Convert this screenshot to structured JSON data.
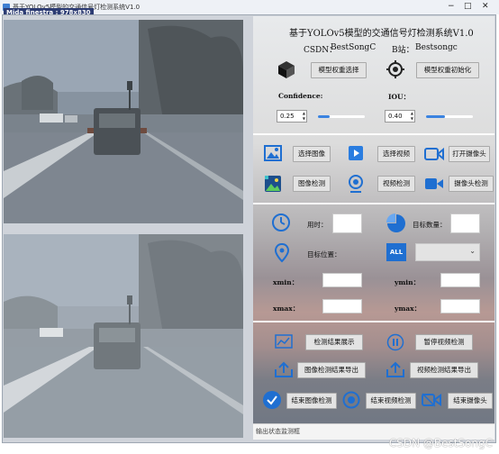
{
  "window": {
    "title": "基于YOLOv5模型的交通信号灯检测系统V1.0",
    "size_overlay": "Mida finestra : 978x830",
    "minimize_glyph": "−",
    "maximize_glyph": "□",
    "close_glyph": "✕"
  },
  "panel": {
    "title": "基于YOLOv5模型的交通信号灯检测系统V1.0",
    "csdn_label": "CSDN：",
    "csdn_value": "BestSongC",
    "bstation_label": "B站：",
    "bstation_value": "Bestsongc"
  },
  "model": {
    "select_button": "模型权重选择",
    "init_button": "模型权重初始化",
    "select_icon": "cube-icon",
    "init_icon": "target-icon"
  },
  "thresholds": {
    "confidence_label": "Confidence:",
    "confidence_value": "0.25",
    "confidence_level": 0.25,
    "iou_label": "IOU：",
    "iou_value": "0.40",
    "iou_level": 0.4,
    "accent_color": "#3b83e0"
  },
  "media": {
    "select_image": "选择图像",
    "select_video": "选择视频",
    "open_camera": "打开摄像头",
    "image_detect": "图像检测",
    "video_detect": "视频检测",
    "camera_detect": "摄像头检测"
  },
  "results": {
    "time_label": "用时：",
    "time_value": "",
    "count_label": "目标数量：",
    "count_value": "",
    "position_label": "目标位置：",
    "position_selected": "",
    "xmin_label": "xmin：",
    "ymin_label": "ymin：",
    "xmax_label": "xmax：",
    "ymax_label": "ymax：",
    "all_badge": "ALL"
  },
  "actions": {
    "show_results": "检测结果展示",
    "pause_video": "暂停视频检测",
    "export_image": "图像检测结果导出",
    "export_video": "视频检测结果导出",
    "end_image": "结束图像检测",
    "end_video": "结束视频检测",
    "end_camera": "结束摄像头"
  },
  "status": {
    "placeholder": "输出状态监测框"
  },
  "watermark": "CSDN @BestSongC"
}
